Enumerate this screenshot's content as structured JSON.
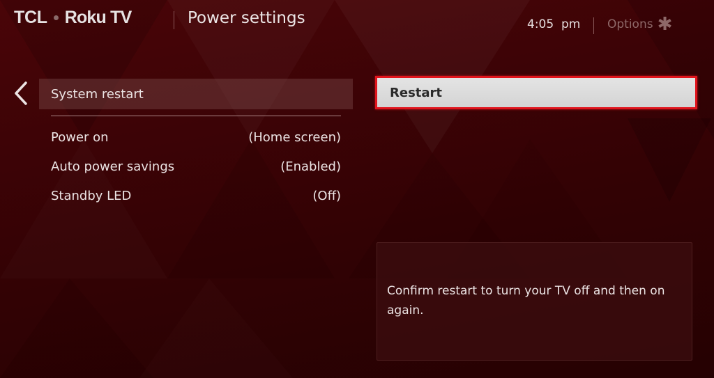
{
  "header": {
    "brand_tcl": "TCL",
    "brand_roku": "Roku TV",
    "page_title": "Power settings",
    "time": "4:05  pm",
    "options_label": "Options",
    "options_icon": "asterisk-icon"
  },
  "menu": {
    "back_icon": "chevron-left-icon",
    "selected_item": "System restart",
    "items": [
      {
        "label": "Power on",
        "value": "(Home screen)"
      },
      {
        "label": "Auto power savings",
        "value": "(Enabled)"
      },
      {
        "label": "Standby LED",
        "value": "(Off)"
      }
    ]
  },
  "panel": {
    "restart_button": "Restart",
    "description": "Confirm restart to turn your TV off and then on again."
  },
  "colors": {
    "background": "#3d0306",
    "focus_border": "#e0141c",
    "button_bg": "#dcdcdc"
  }
}
